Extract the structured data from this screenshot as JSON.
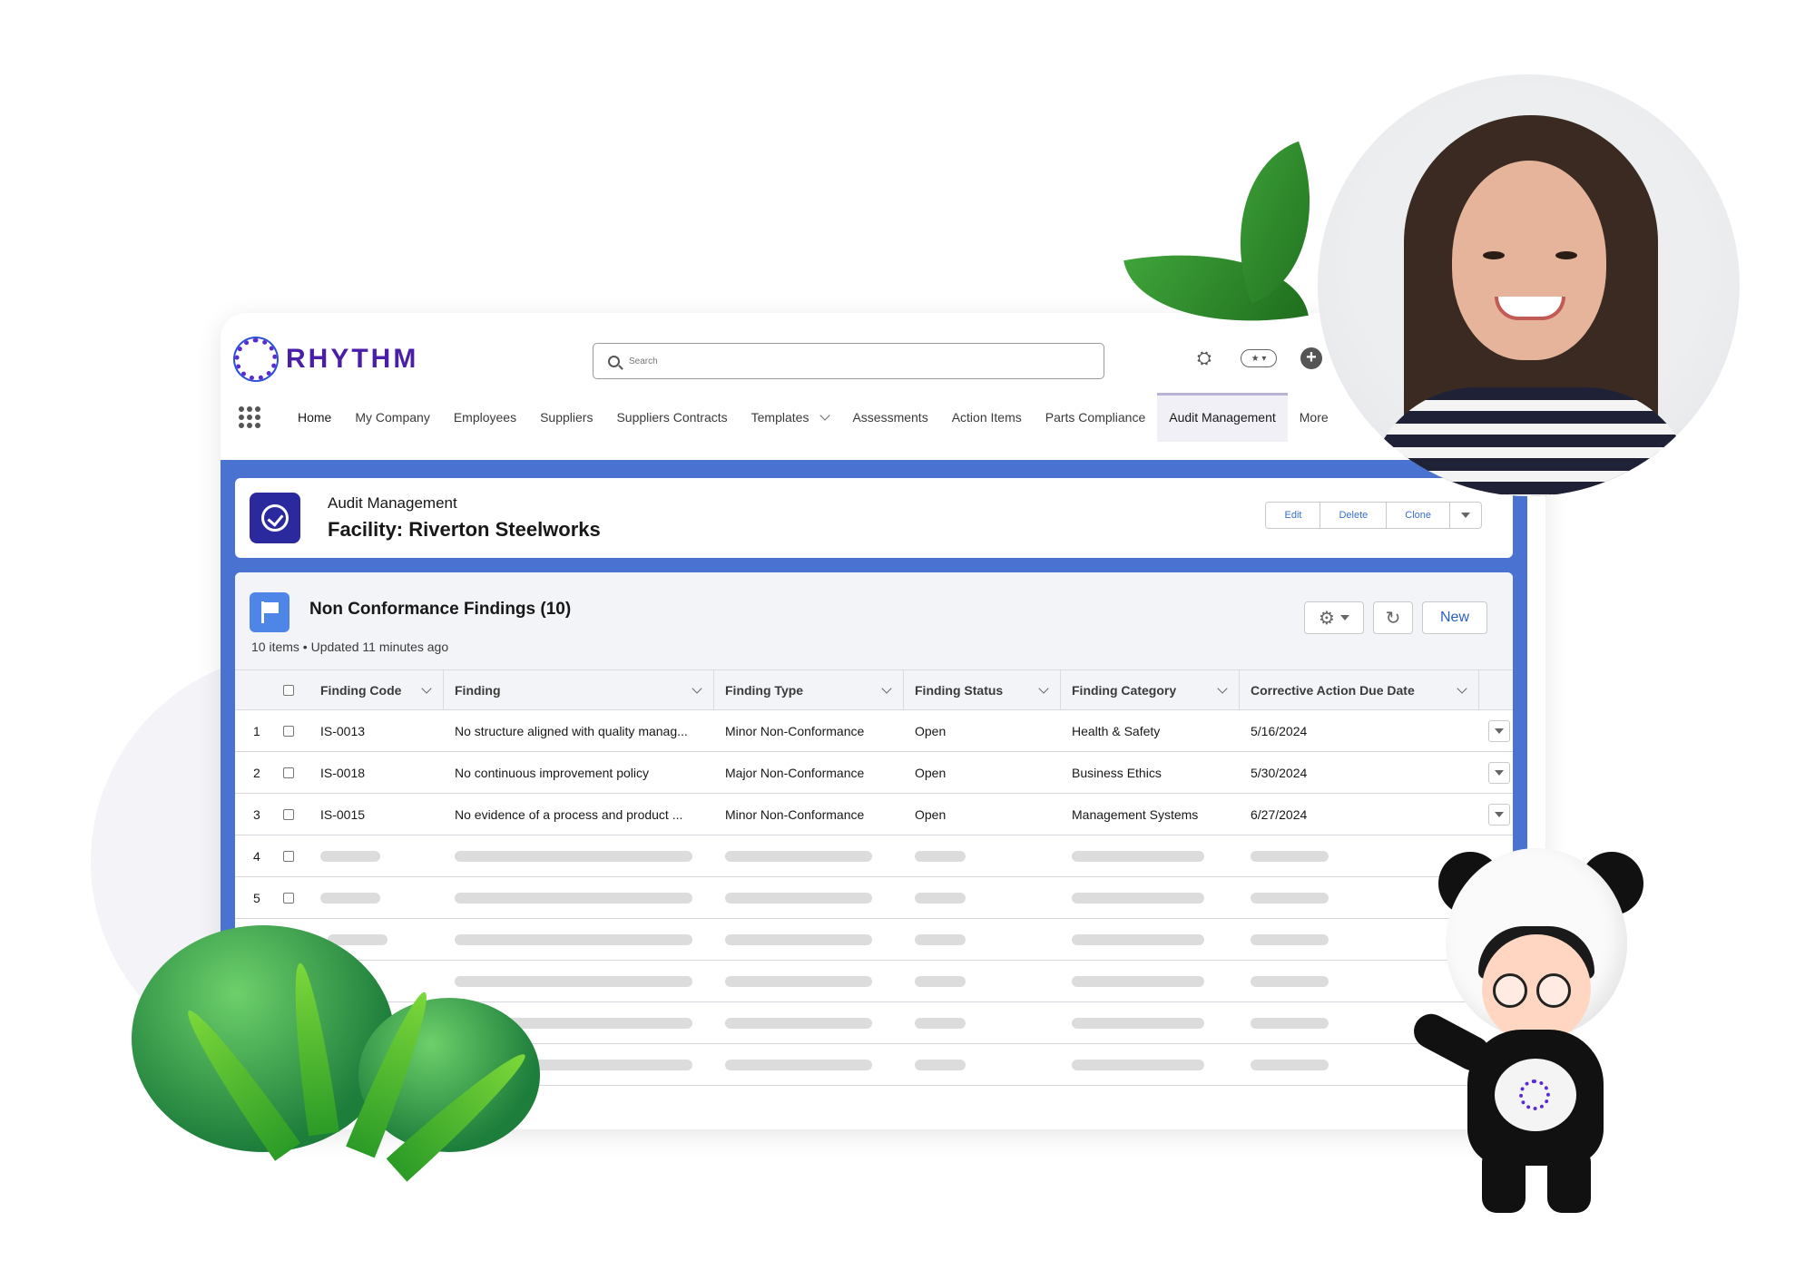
{
  "app": {
    "brand": "RHYTHM",
    "search_placeholder": "Search"
  },
  "nav": {
    "items": [
      {
        "label": "Home"
      },
      {
        "label": "My Company"
      },
      {
        "label": "Employees"
      },
      {
        "label": "Suppliers"
      },
      {
        "label": "Suppliers Contracts"
      },
      {
        "label": "Templates"
      },
      {
        "label": "Assessments"
      },
      {
        "label": "Action Items"
      },
      {
        "label": "Parts Compliance"
      },
      {
        "label": "Audit Management"
      },
      {
        "label": "More"
      }
    ],
    "active": "Audit Management"
  },
  "record": {
    "object_label": "Audit Management",
    "title": "Facility: Riverton Steelworks",
    "actions": [
      "Edit",
      "Delete",
      "Clone"
    ]
  },
  "related_list": {
    "title": "Non Conformance Findings (10)",
    "meta": "10 items • Updated 11 minutes ago",
    "new_label": "New",
    "columns": [
      "Finding Code",
      "Finding",
      "Finding Type",
      "Finding Status",
      "Finding Category",
      "Corrective Action Due Date"
    ],
    "rows": [
      {
        "num": "1",
        "code": "IS-0013",
        "finding": "No structure aligned with quality manag...",
        "type": "Minor Non-Conformance",
        "status": "Open",
        "category": "Health & Safety",
        "due": "5/16/2024"
      },
      {
        "num": "2",
        "code": "IS-0018",
        "finding": "No continuous improvement policy",
        "type": "Major Non-Conformance",
        "status": "Open",
        "category": "Business Ethics",
        "due": "5/30/2024"
      },
      {
        "num": "3",
        "code": "IS-0015",
        "finding": "No evidence of a process and product ...",
        "type": "Minor Non-Conformance",
        "status": "Open",
        "category": "Management Systems",
        "due": "6/27/2024"
      }
    ],
    "placeholder_row_numbers": [
      "4",
      "5"
    ]
  },
  "colors": {
    "brand": "#4a1fa8",
    "content_bg": "#4a73d1",
    "link": "#3a6fd0"
  }
}
